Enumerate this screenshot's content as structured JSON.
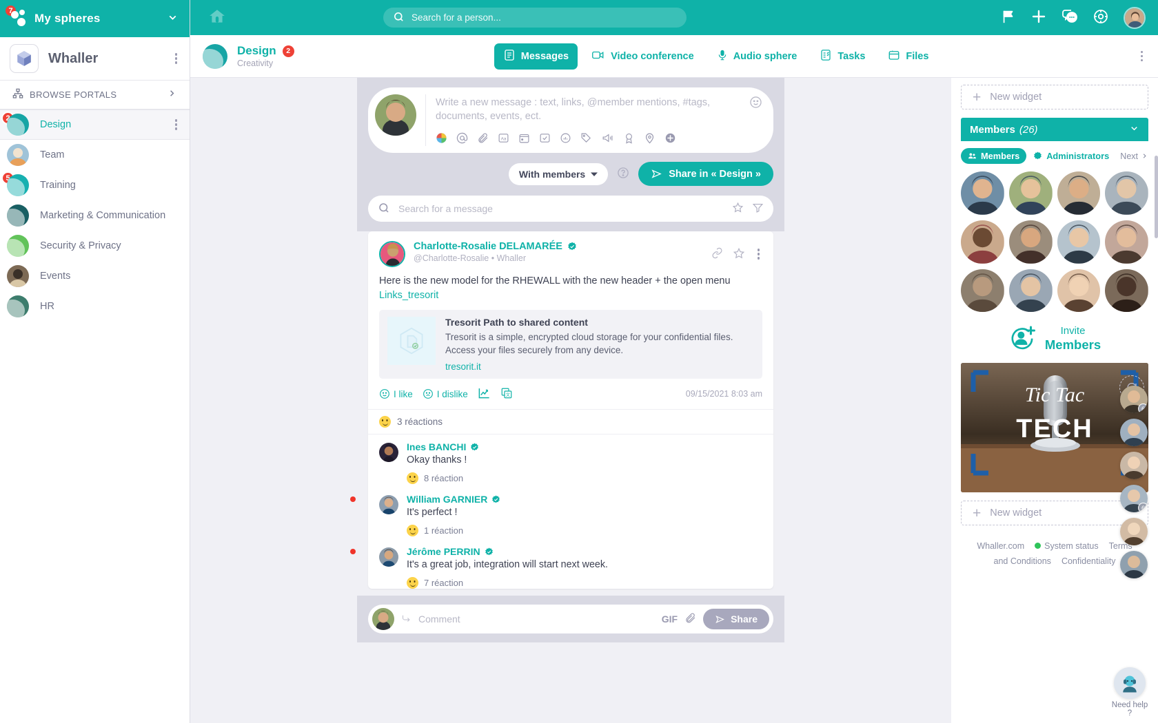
{
  "sidebar": {
    "header": {
      "title": "My spheres",
      "badge": "7",
      "chevron": "chevron-down-icon"
    },
    "org": {
      "name": "Whaller",
      "menu": "kebab-menu-icon"
    },
    "browse": {
      "label": "BROWSE PORTALS",
      "arrow": "chevron-right-icon"
    },
    "spheres": [
      {
        "label": "Design",
        "badge": "2",
        "color": "#17a5a5",
        "active": true
      },
      {
        "label": "Team",
        "badge": "",
        "color": "#b7c4cf",
        "active": false
      },
      {
        "label": "Training",
        "badge": "5",
        "color": "#17b0b0",
        "active": false
      },
      {
        "label": "Marketing & Communication",
        "badge": "",
        "color": "#195f63",
        "active": false
      },
      {
        "label": "Security & Privacy",
        "badge": "",
        "color": "#62c martin",
        "active": false
      },
      {
        "label": "Events",
        "badge": "",
        "color": "#7d6a55",
        "active": false
      },
      {
        "label": "HR",
        "badge": "",
        "color": "#3d7d6d",
        "active": false
      }
    ]
  },
  "topbar": {
    "home_icon": "home-icon",
    "search": {
      "placeholder": "Search for a person...",
      "icon": "search-icon"
    },
    "icons": [
      "flag-icon",
      "plus-icon",
      "chat-bubbles-icon",
      "settings-gear-icon"
    ],
    "avatar": "user-avatar"
  },
  "sphere_header": {
    "name": "Design",
    "badge": "2",
    "subtitle": "Creativity",
    "tabs": [
      {
        "label": "Messages",
        "icon": "messages-icon",
        "selected": true
      },
      {
        "label": "Video conference",
        "icon": "video-camera-icon",
        "selected": false
      },
      {
        "label": "Audio sphere",
        "icon": "microphone-icon",
        "selected": false
      },
      {
        "label": "Tasks",
        "icon": "tasks-icon",
        "selected": false
      },
      {
        "label": "Files",
        "icon": "files-icon",
        "selected": false
      }
    ],
    "more": "kebab-menu-icon"
  },
  "composer": {
    "placeholder": "Write a new message : text, links, @member mentions, #tags, documents, events, ect.",
    "icons": [
      "emoji-palette-icon",
      "mention-icon",
      "attachment-icon",
      "text-format-icon",
      "event-icon",
      "checklist-icon",
      "poll-icon",
      "tag-icon",
      "announcement-icon",
      "badge-icon",
      "location-icon",
      "add-more-icon"
    ],
    "smiley": "smiley-icon",
    "audience": {
      "label": "With members",
      "caret": "caret-down-icon"
    },
    "help": "help-icon",
    "share_button": "Share in « Design »",
    "share_icon": "send-icon"
  },
  "message_search": {
    "placeholder": "Search for a message",
    "icon": "search-icon",
    "star": "star-icon",
    "filter": "filter-icon"
  },
  "post": {
    "author": "Charlotte-Rosalie DELAMARÉE",
    "verified": "verified-badge-icon",
    "handle": "@Charlotte-Rosalie",
    "separator": "•",
    "org": "Whaller",
    "tools": [
      "link-icon",
      "star-icon",
      "kebab-menu-icon"
    ],
    "body": "Here is the new model for the RHEWALL  with the new header + the open menu",
    "link_text": "Links_tresorit",
    "preview": {
      "title": "Tresorit Path to shared content",
      "description": "Tresorit is a simple, encrypted cloud storage for your confidential files. Access your files securely from any device.",
      "url": "tresorit.it",
      "thumb": "document-share-icon"
    },
    "actions": [
      {
        "label": "I like",
        "icon": "smiley-outline-icon"
      },
      {
        "label": "I dislike",
        "icon": "frowny-outline-icon"
      }
    ],
    "stats_icon": "stats-icon",
    "translate_icon": "translate-icon",
    "timestamp": "09/15/2021 8:03 am",
    "reactions_summary": "3 réactions"
  },
  "comments": [
    {
      "author": "Ines BANCHI",
      "text": "Okay thanks !",
      "reactions": "8 réaction",
      "unread": false
    },
    {
      "author": "William GARNIER",
      "text": "It's perfect !",
      "reactions": "1 réaction",
      "unread": true
    },
    {
      "author": "Jérôme PERRIN",
      "text": "It's a great job, integration will start next week.",
      "reactions": "7 réaction",
      "unread": true
    }
  ],
  "comment_bar": {
    "placeholder": "Comment",
    "reply_icon": "reply-arrow-icon",
    "gif_label": "GIF",
    "attach_icon": "attachment-icon",
    "share_label": "Share",
    "share_icon": "send-icon"
  },
  "widgets": {
    "new_widget_top": "New widget",
    "new_widget_bottom": "New widget",
    "members": {
      "title": "Members",
      "count": "(26)",
      "chevron": "chevron-down-icon",
      "tab_members": "Members",
      "tab_admins": "Administrators",
      "next": "Next",
      "next_icon": "chevron-right-icon",
      "invite_line1": "Invite",
      "invite_line2": "Members",
      "invite_icon": "add-person-icon",
      "avatars": [
        {
          "status": "#3fc45a"
        },
        {
          "status": "#3fc45a"
        },
        {
          "status": "#c9c9d4"
        },
        {
          "status": "#c9c9d4"
        },
        {
          "status": "#3fc45a"
        },
        {
          "status": "#f5a623"
        },
        {
          "status": "#c9c9d4"
        },
        {
          "status": "#c9c9d4"
        },
        {
          "status": "#f5a623"
        },
        {
          "status": "#c9c9d4"
        },
        {
          "status": "#c9c9d4"
        },
        {
          "status": "#3fc45a"
        }
      ]
    },
    "promo": {
      "line1": "Tic Tac",
      "line2": "TECH",
      "alt": "microphone-photo"
    }
  },
  "footer": {
    "links_row1": [
      "Whaller.com",
      "System status",
      "Terms"
    ],
    "links_row2": [
      "and Conditions",
      "Confidentiality"
    ],
    "status_color": "#2fc45a"
  },
  "rail": {
    "refresh_icon": "refresh-icon",
    "contacts": [
      {
        "unread": true,
        "count": "6"
      },
      {
        "unread": true,
        "count": ""
      },
      {
        "unread": false,
        "count": ""
      },
      {
        "unread": false,
        "count": "6"
      },
      {
        "unread": false,
        "count": ""
      },
      {
        "unread": false,
        "count": ""
      }
    ],
    "help_label": "Need help ?",
    "help_icon": "support-agent-icon"
  }
}
